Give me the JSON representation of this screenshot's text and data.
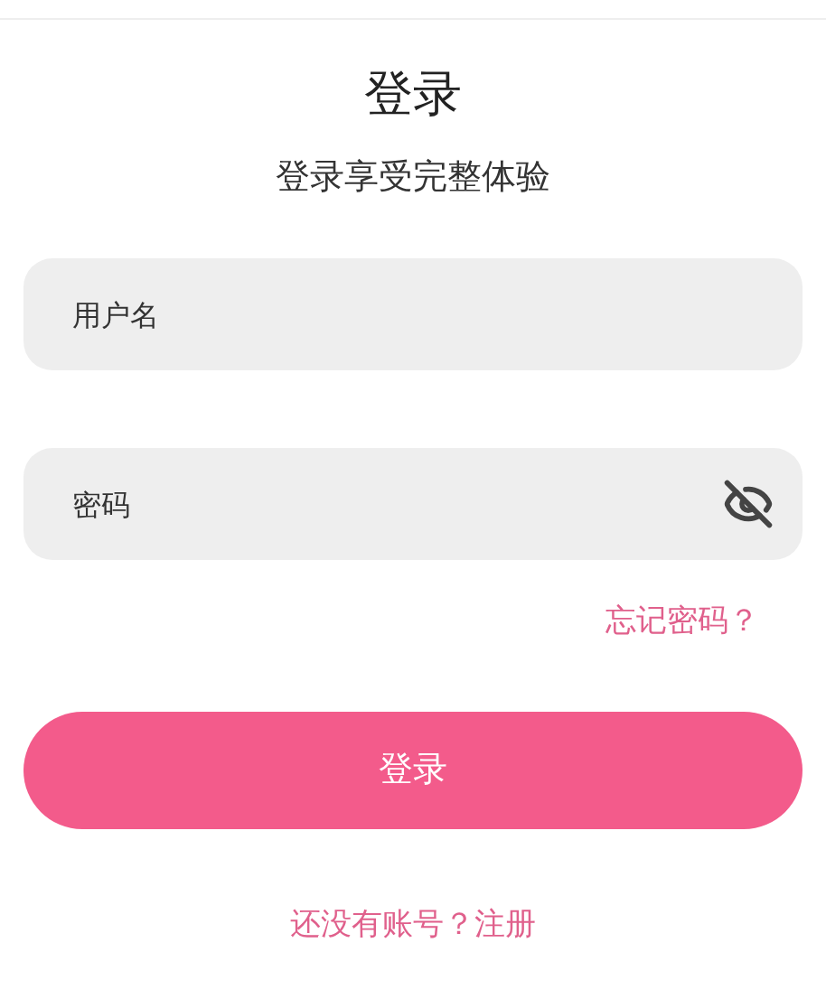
{
  "title": "登录",
  "subtitle": "登录享受完整体验",
  "username": {
    "placeholder": "用户名"
  },
  "password": {
    "placeholder": "密码",
    "visible": false
  },
  "forgot_link": "忘记密码？",
  "login_button": "登录",
  "register_link": "还没有账号？注册"
}
